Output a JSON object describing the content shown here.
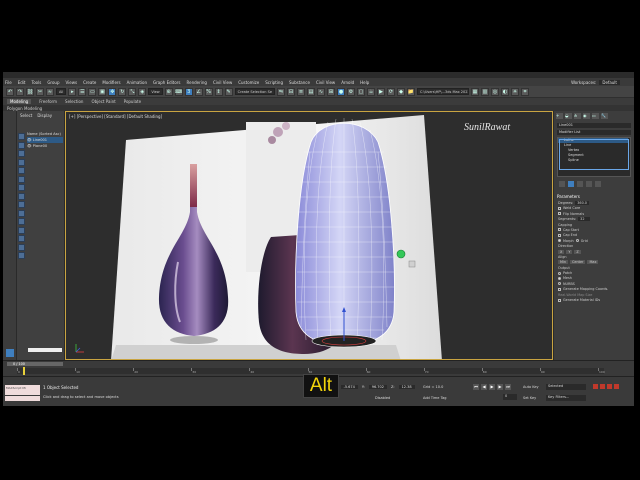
{
  "menubar": {
    "items": [
      "File",
      "Edit",
      "Tools",
      "Group",
      "Views",
      "Create",
      "Modifiers",
      "Animation",
      "Graph Editors",
      "Rendering",
      "Civil View",
      "Customize",
      "Scripting",
      "Substance",
      "Civil View",
      "Arnold",
      "Help"
    ],
    "workspaces_label": "Workspaces:",
    "workspace_value": "Default"
  },
  "toolbar": {
    "filter_dropdown": "All",
    "view_dropdown": "View",
    "selection_set": "Create Selection Se",
    "path": "C:\\Users\\HP\\...3ds Max 2022"
  },
  "ribbon": {
    "tabs": [
      "Modeling",
      "Freeform",
      "Selection",
      "Object Paint",
      "Populate"
    ],
    "active": "Modeling",
    "sub": "Polygon Modeling"
  },
  "scene_explorer": {
    "tabs": [
      "Select",
      "Display"
    ],
    "items": [
      "Name (Sorted Asc)",
      "Line001",
      "Plane00"
    ]
  },
  "viewport": {
    "label": "[+] [Perspective] [Standard] [Default Shading]",
    "watermark": "SunilRawat"
  },
  "command_panel": {
    "object_name": "Line001",
    "modifier_list": "Modifier List",
    "stack": [
      "Lathe",
      "Line",
      "Vertex",
      "Segment",
      "Spline"
    ],
    "parameters_title": "Parameters",
    "degrees_label": "Degrees:",
    "degrees_value": "360.0",
    "weld_core": "Weld Core",
    "flip_normals": "Flip Normals",
    "segments_label": "Segments:",
    "segments_value": "32",
    "capping_label": "Capping",
    "cap_start": "Cap Start",
    "cap_end": "Cap End",
    "morph": "Morph",
    "grid": "Grid",
    "direction_label": "Direction",
    "dir_x": "X",
    "dir_y": "Y",
    "dir_z": "Z",
    "align_label": "Align",
    "align_min": "Min",
    "align_center": "Center",
    "align_max": "Max",
    "output_label": "Output",
    "out_patch": "Patch",
    "out_mesh": "Mesh",
    "out_nurbs": "NURBS",
    "gen_mapping": "Generate Mapping Coords.",
    "real_world": "Real-World Map Size",
    "gen_material": "Generate Material IDs"
  },
  "timeline": {
    "slider_label": "0 / 100",
    "ticks": [
      "0",
      "10",
      "20",
      "30",
      "40",
      "50",
      "60",
      "70",
      "80",
      "90",
      "100"
    ]
  },
  "status": {
    "maxscript": "MAXScript Mi",
    "objects_selected": "1 Object Selected",
    "hint": "Click and drag to select and move objects",
    "x_label": "X:",
    "x_value": "-5.674",
    "y_label": "Y:",
    "y_value": "96.702",
    "z_label": "Z:",
    "z_value": "12.38",
    "grid": "Grid = 10.0",
    "disabled": "Disabled",
    "add_time_tag": "Add Time Tag",
    "frame": "0",
    "autokey": "Auto Key",
    "setkey": "Set Key",
    "selected": "Selected",
    "key_filters": "Key Filters..."
  },
  "overlay": {
    "key_caption": "Alt"
  }
}
